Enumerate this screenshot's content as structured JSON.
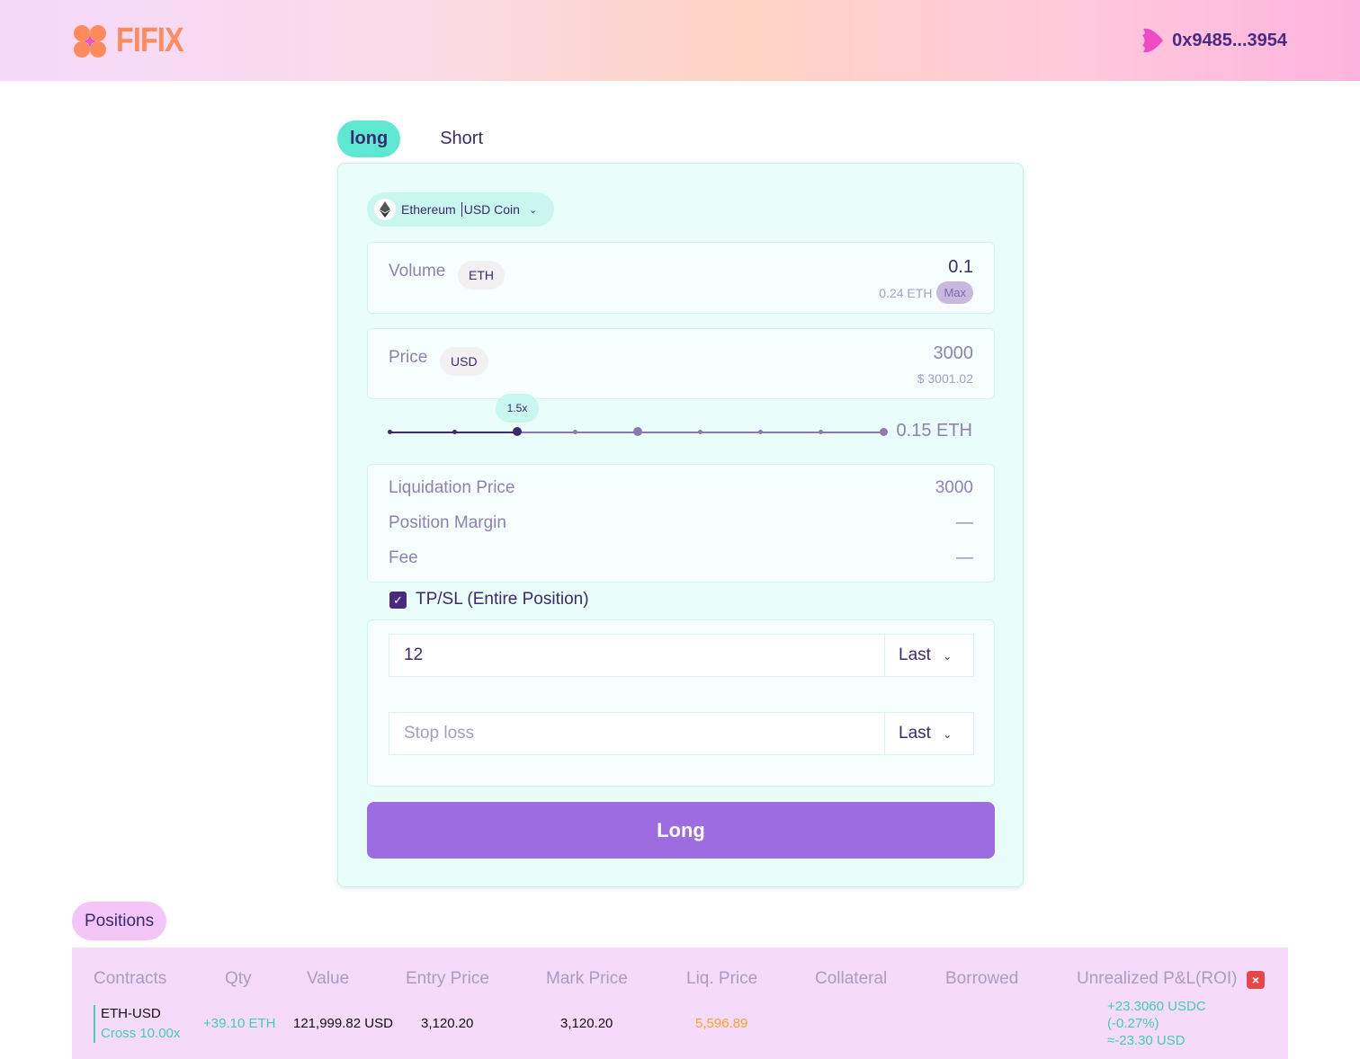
{
  "header": {
    "logo_text": "FIFIX",
    "wallet_address": "0x9485...3954"
  },
  "tabs": [
    {
      "label": "long",
      "active": true
    },
    {
      "label": "Short",
      "active": false
    }
  ],
  "form": {
    "pair": {
      "base": "Ethereum",
      "quote": "USD Coin"
    },
    "volume": {
      "label": "Volume",
      "unit": "ETH",
      "value": "0.1",
      "balance": "0.24 ETH",
      "max_label": "Max"
    },
    "price": {
      "label": "Price",
      "unit": "USD",
      "value": "3000",
      "sub": "$ 3001.02"
    },
    "leverage": {
      "tooltip": "1.5x",
      "amount": "0.15 ETH",
      "fraction": 0.26
    },
    "summary": [
      {
        "label": "Liquidation Price",
        "value": "3000"
      },
      {
        "label": "Position Margin",
        "value": "—"
      },
      {
        "label": "Fee",
        "value": "—"
      }
    ],
    "tpsl": {
      "label": "TP/SL (Entire Position)",
      "checked": true,
      "take_profit_value": "12",
      "tp_mode": "Last",
      "stop_loss_placeholder": "Stop loss",
      "sl_mode": "Last"
    },
    "submit_label": "Long"
  },
  "positions": {
    "tab_label": "Positions",
    "columns": [
      "Contracts",
      "Qty",
      "Value",
      "Entry Price",
      "Mark Price",
      "Liq. Price",
      "Collateral",
      "Borrowed",
      "Unrealized P&L(ROI)"
    ],
    "rows": [
      {
        "contract": "ETH-USD",
        "mode": "Cross 10.00x",
        "qty": "+39.10 ETH",
        "value": "121,999.82 USD",
        "entry": "3,120.20",
        "mark": "3,120.20",
        "liq": "5,596.89",
        "pnl": "+23.3060 USDC",
        "roi": "(-0.27%)",
        "pnl_usd": "≈-23.30 USD"
      }
    ]
  },
  "colors": {
    "accent": "#9c6ce0",
    "tab_active": "#5ee8d2",
    "positive": "#3ecfb4",
    "liq": "#f5a623",
    "close": "#e84545"
  }
}
